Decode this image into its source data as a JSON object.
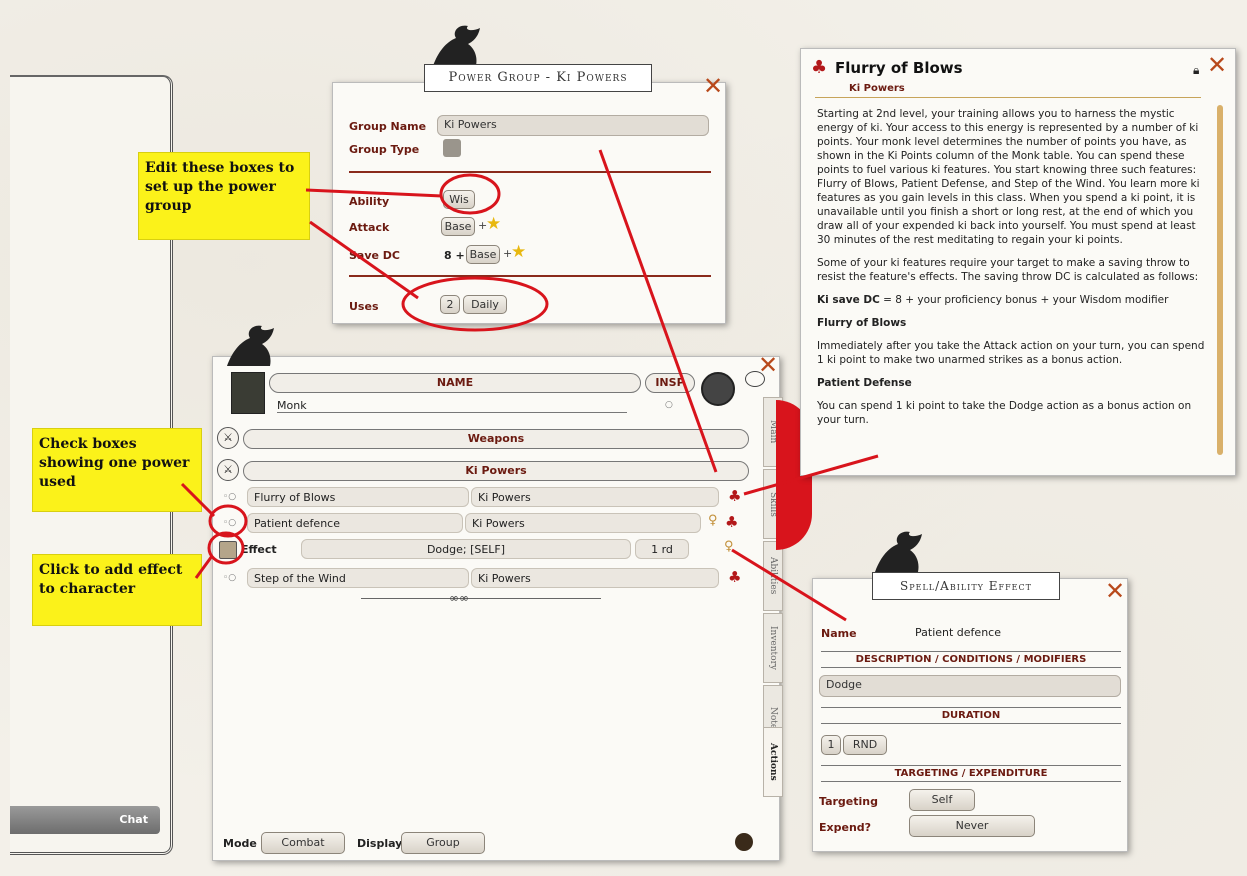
{
  "callouts": {
    "edit_boxes": "Edit these boxes to set up the power group",
    "check_boxes": "Check boxes showing one power used",
    "click_add": "Click to add effect to character"
  },
  "chat": {
    "label": "Chat"
  },
  "power_group": {
    "title": "Power Group - Ki Powers",
    "group_name_label": "Group Name",
    "group_name_value": "Ki Powers",
    "group_type_label": "Group Type",
    "ability_label": "Ability",
    "ability_value": "Wis",
    "attack_label": "Attack",
    "attack_base": "Base",
    "savedc_label": "Save DC",
    "savedc_prefix": "8 +",
    "savedc_base": "Base",
    "uses_label": "Uses",
    "uses_value": "2",
    "uses_period": "Daily",
    "plus": "+"
  },
  "sheet": {
    "name_header": "NAME",
    "insp": "INSP",
    "char_name": "Monk",
    "weapons": "Weapons",
    "ki_powers": "Ki Powers",
    "rows": [
      {
        "name": "Flurry of Blows",
        "group": "Ki Powers"
      },
      {
        "name": "Patient defence",
        "group": "Ki Powers"
      },
      {
        "name": "Step of the Wind",
        "group": "Ki Powers"
      }
    ],
    "effect": {
      "label": "Effect",
      "value": "Dodge; [SELF]",
      "duration": "1 rd"
    },
    "mode_label": "Mode",
    "mode_value": "Combat",
    "display_label": "Display",
    "display_value": "Group",
    "tabs": [
      "Main",
      "Skills",
      "Abilities",
      "Inventory",
      "Notes",
      "Actions"
    ]
  },
  "desc_window": {
    "title": "Flurry of Blows",
    "subtitle": "Ki Powers",
    "p1": "Starting at 2nd level, your training allows you to harness the mystic energy of ki. Your access to this energy is represented by a number of ki points. Your monk level determines the number of points you have, as shown in the Ki Points column of the Monk table. You can spend these points to fuel various ki features. You start knowing three such features: Flurry of Blows, Patient Defense, and Step of the Wind. You learn more ki features as you gain levels in this class. When you spend a ki point, it is unavailable until you finish a short or long rest, at the end of which you draw all of your expended ki back into yourself. You must spend at least 30 minutes of the rest meditating to regain your ki points.",
    "p2": "Some of your ki features require your target to make a saving throw to resist the feature's effects. The saving throw DC is calculated as follows:",
    "p3_bold": "Ki save DC",
    "p3_rest": " = 8 + your proficiency bonus + your Wisdom modifier",
    "h1": "Flurry of Blows",
    "p4": "Immediately after you take the Attack action on your turn, you can spend 1 ki point to make two unarmed strikes as a bonus action.",
    "h2": "Patient Defense",
    "p5": "You can spend 1 ki point to take the Dodge action as a bonus action on your turn."
  },
  "effect_window": {
    "title": "Spell/Ability Effect",
    "name_label": "Name",
    "name_value": "Patient defence",
    "desc_header": "DESCRIPTION / CONDITIONS / MODIFIERS",
    "desc_value": "Dodge",
    "duration_header": "DURATION",
    "duration_num": "1",
    "duration_unit": "RND",
    "targeting_header": "TARGETING / EXPENDITURE",
    "targeting_label": "Targeting",
    "targeting_value": "Self",
    "expend_label": "Expend?",
    "expend_value": "Never"
  },
  "colors": {
    "accent": "#b8491b",
    "callout": "#fbf21a",
    "annotation": "#d8141c",
    "label": "#6b1a10"
  }
}
